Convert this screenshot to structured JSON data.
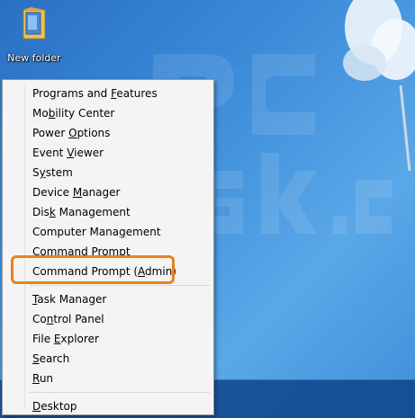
{
  "desktop": {
    "icon_label": "New folder",
    "watermark_text": "PC risk.com"
  },
  "menu": {
    "group1": [
      {
        "pre": "Programs and ",
        "u": "F",
        "post": "eatures"
      },
      {
        "pre": "Mo",
        "u": "b",
        "post": "ility Center"
      },
      {
        "pre": "Power ",
        "u": "O",
        "post": "ptions"
      },
      {
        "pre": "Event ",
        "u": "V",
        "post": "iewer"
      },
      {
        "pre": "S",
        "u": "y",
        "post": "stem"
      },
      {
        "pre": "Device ",
        "u": "M",
        "post": "anager"
      },
      {
        "pre": "Dis",
        "u": "k",
        "post": " Management"
      },
      {
        "pre": "Computer Mana",
        "u": "g",
        "post": "ement"
      },
      {
        "pre": "",
        "u": "C",
        "post": "ommand Prompt"
      },
      {
        "pre": "Command Prompt (",
        "u": "A",
        "post": "dmin)"
      }
    ],
    "group2": [
      {
        "pre": "",
        "u": "T",
        "post": "ask Manager"
      },
      {
        "pre": "Co",
        "u": "n",
        "post": "trol Panel"
      },
      {
        "pre": "File ",
        "u": "E",
        "post": "xplorer"
      },
      {
        "pre": "",
        "u": "S",
        "post": "earch"
      },
      {
        "pre": "",
        "u": "R",
        "post": "un"
      }
    ],
    "group3": [
      {
        "pre": "",
        "u": "D",
        "post": "esktop"
      }
    ]
  },
  "colors": {
    "highlight": "#e8821f",
    "menu_bg": "#f4f4f4",
    "desktop_bg": "#3a8ad8"
  }
}
